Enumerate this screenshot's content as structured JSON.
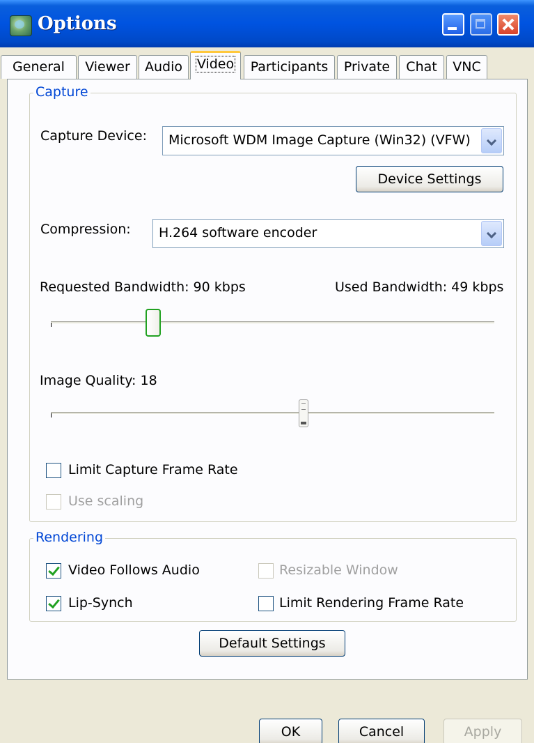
{
  "window": {
    "title": "Options"
  },
  "tabs": [
    {
      "label": "General",
      "active": false
    },
    {
      "label": "Viewer",
      "active": false
    },
    {
      "label": "Audio",
      "active": false
    },
    {
      "label": "Video",
      "active": true
    },
    {
      "label": "Participants",
      "active": false
    },
    {
      "label": "Private",
      "active": false
    },
    {
      "label": "Chat",
      "active": false
    },
    {
      "label": "VNC",
      "active": false
    }
  ],
  "capture": {
    "group_label": "Capture",
    "device_label": "Capture Device:",
    "device_value": "Microsoft WDM Image Capture (Win32) (VFW)",
    "device_settings_button": "Device Settings",
    "compression_label": "Compression:",
    "compression_value": "H.264 software encoder",
    "requested_bandwidth_label": "Requested Bandwidth: 90 kbps",
    "used_bandwidth_label": "Used Bandwidth: 49 kbps",
    "bandwidth_slider_fraction": 0.23,
    "image_quality_label": "Image Quality: 18",
    "quality_slider_fraction": 0.57,
    "limit_frame_rate": {
      "label": "Limit Capture Frame Rate",
      "checked": false,
      "enabled": true
    },
    "use_scaling": {
      "label": "Use scaling",
      "checked": false,
      "enabled": false
    }
  },
  "rendering": {
    "group_label": "Rendering",
    "video_follows_audio": {
      "label": "Video Follows Audio",
      "checked": true,
      "enabled": true
    },
    "resizable_window": {
      "label": "Resizable Window",
      "checked": false,
      "enabled": false
    },
    "lip_synch": {
      "label": "Lip-Synch",
      "checked": true,
      "enabled": true
    },
    "limit_rendering_frame_rate": {
      "label": "Limit Rendering Frame Rate",
      "checked": false,
      "enabled": true
    }
  },
  "buttons": {
    "default_settings": "Default Settings",
    "ok": "OK",
    "cancel": "Cancel",
    "apply": "Apply"
  }
}
